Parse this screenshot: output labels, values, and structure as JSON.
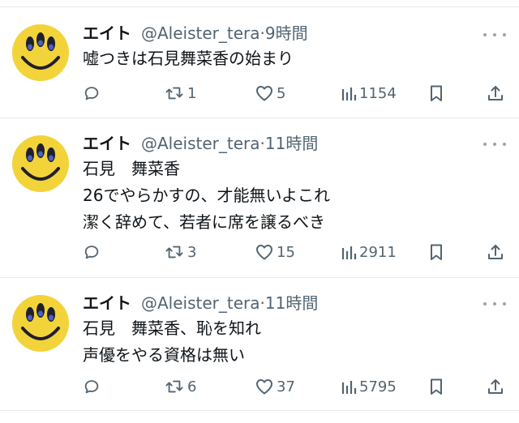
{
  "tweets": [
    {
      "name": "エイト",
      "handle": "@Aleister_tera",
      "dot": "·",
      "time": "9時間",
      "lines": [
        "嘘つきは石見舞菜香の始まり"
      ],
      "retweets": "1",
      "likes": "5",
      "views": "1154"
    },
    {
      "name": "エイト",
      "handle": "@Aleister_tera",
      "dot": "·",
      "time": "11時間",
      "lines": [
        "石見　舞菜香",
        "26でやらかすの、才能無いよこれ",
        "潔く辞めて、若者に席を譲るべき"
      ],
      "retweets": "3",
      "likes": "15",
      "views": "2911"
    },
    {
      "name": "エイト",
      "handle": "@Aleister_tera",
      "dot": "·",
      "time": "11時間",
      "lines": [
        "石見　舞菜香、恥を知れ",
        "声優をやる資格は無い"
      ],
      "retweets": "6",
      "likes": "37",
      "views": "5795"
    }
  ],
  "icons": {
    "reply": "reply-icon",
    "retweet": "retweet-icon",
    "like": "heart-icon",
    "views": "views-icon",
    "bookmark": "bookmark-icon",
    "share": "share-icon",
    "more": "more-icon"
  },
  "colors": {
    "icon_gray": "#536471",
    "avatar_yellow": "#f2d43a",
    "avatar_dark": "#1f1f2e"
  }
}
